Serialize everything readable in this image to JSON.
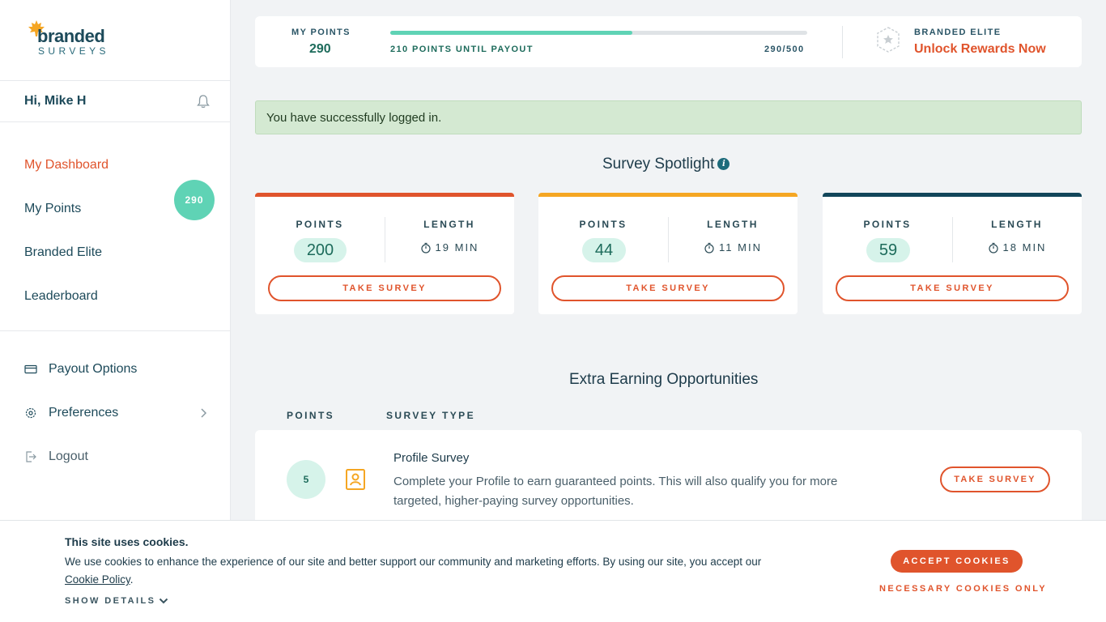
{
  "brand": {
    "name": "branded",
    "sub": "SURVEYS"
  },
  "user": {
    "greeting": "Hi, Mike H"
  },
  "nav": {
    "items": [
      {
        "label": "My Dashboard"
      },
      {
        "label": "My Points"
      },
      {
        "label": "Branded Elite"
      },
      {
        "label": "Leaderboard"
      }
    ],
    "points_badge": "290",
    "secondary": [
      {
        "label": "Payout Options",
        "icon": "card-icon"
      },
      {
        "label": "Preferences",
        "icon": "gear-icon"
      },
      {
        "label": "Logout",
        "icon": "logout-icon"
      }
    ]
  },
  "topbar": {
    "my_points_label": "MY POINTS",
    "my_points_value": "290",
    "until_payout": "210 POINTS UNTIL PAYOUT",
    "progress_text": "290/500",
    "progress_fraction": 0.58,
    "elite_label": "BRANDED ELITE",
    "unlock_label": "Unlock Rewards Now"
  },
  "alert": {
    "message": "You have successfully logged in."
  },
  "spotlight": {
    "title": "Survey Spotlight",
    "info_glyph": "i",
    "points_header": "POINTS",
    "length_header": "LENGTH",
    "button_label": "TAKE SURVEY",
    "cards": [
      {
        "points": "200",
        "length": "19 MIN",
        "color": "#e0542c"
      },
      {
        "points": "44",
        "length": "11 MIN",
        "color": "#f5a623"
      },
      {
        "points": "59",
        "length": "18 MIN",
        "color": "#12465a"
      }
    ]
  },
  "extra": {
    "title": "Extra Earning Opportunities",
    "col_points": "POINTS",
    "col_type": "SURVEY TYPE",
    "items": [
      {
        "points": "5",
        "title": "Profile Survey",
        "description": "Complete your Profile to earn guaranteed points. This will also qualify you for more targeted, higher-paying survey opportunities.",
        "button": "TAKE SURVEY"
      }
    ]
  },
  "cookie": {
    "title": "This site uses cookies.",
    "text": "We use cookies to enhance the experience of our site and better support our community and marketing efforts. By using our site, you accept our",
    "link": "Cookie Policy",
    "link_suffix": ".",
    "show_details": "SHOW DETAILS",
    "accept": "ACCEPT COOKIES",
    "necessary": "NECESSARY COOKIES ONLY"
  },
  "colors": {
    "accent": "#e0542c",
    "teal": "#5fd3b5",
    "navy": "#1d4a5a"
  }
}
